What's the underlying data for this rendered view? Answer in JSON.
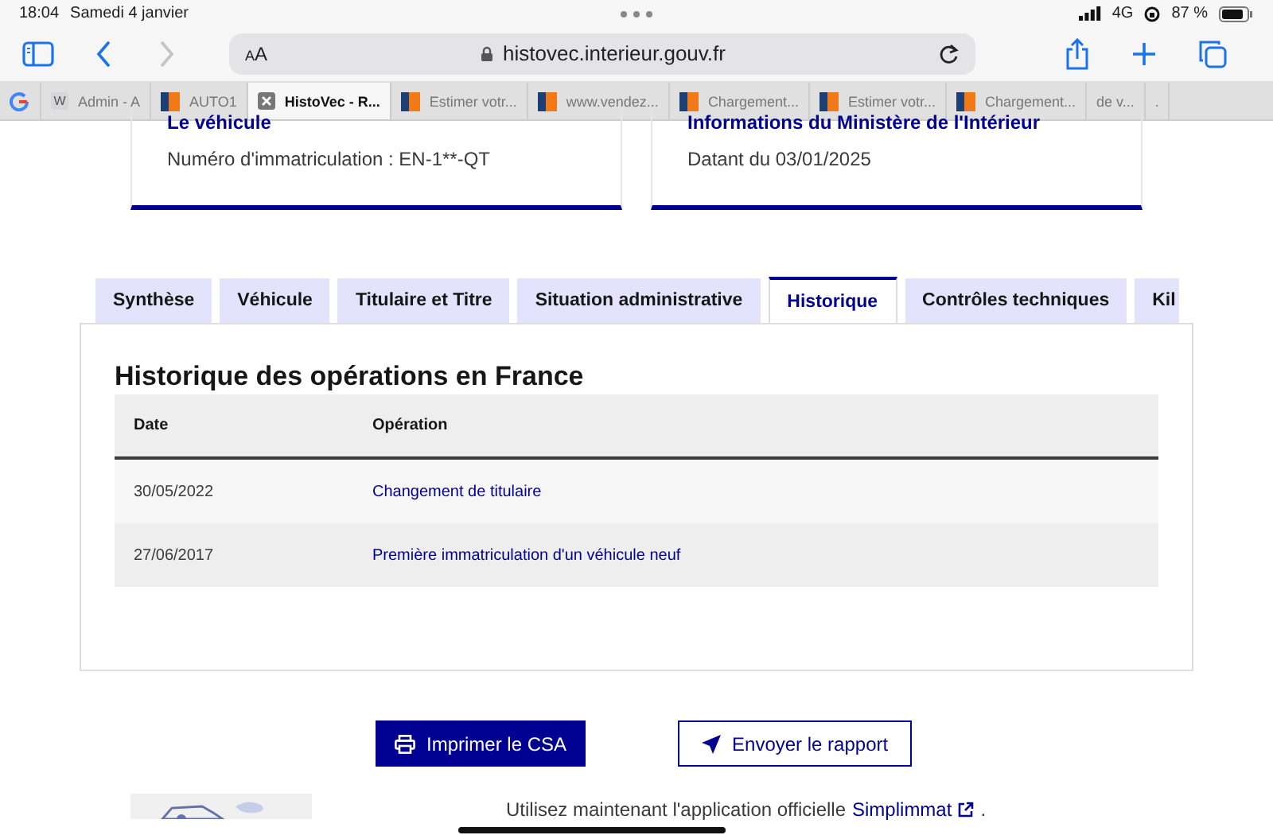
{
  "status_bar": {
    "time": "18:04",
    "date": "Samedi 4 janvier",
    "network": "4G",
    "battery": "87 %"
  },
  "toolbar": {
    "text_size": "AA",
    "url": "histovec.interieur.gouv.fr",
    "forward_disabled": true
  },
  "browser_tabs": [
    {
      "kind": "google",
      "selected": false
    },
    {
      "label": "Admin - A",
      "kind": "letter",
      "letter": "W",
      "selected": false
    },
    {
      "label": "AUTO1",
      "kind": "flag",
      "selected": false
    },
    {
      "label": "HistoVec - R...",
      "kind": "close",
      "selected": true
    },
    {
      "label": "Estimer votr...",
      "kind": "flag",
      "selected": false
    },
    {
      "label": "www.vendez...",
      "kind": "flag",
      "selected": false
    },
    {
      "label": "Chargement...",
      "kind": "flag",
      "selected": false
    },
    {
      "label": "Estimer votr...",
      "kind": "flag",
      "selected": false
    },
    {
      "label": "Chargement...",
      "kind": "flag",
      "selected": false
    },
    {
      "label": "de v...",
      "kind": "plain",
      "selected": false
    },
    {
      "label": ".",
      "kind": "plain",
      "selected": false
    }
  ],
  "cards": [
    {
      "title": "Le véhicule",
      "text": "Numéro d'immatriculation : EN-1**-QT"
    },
    {
      "title": "Informations du Ministère de l'Intérieur",
      "text": "Datant du 03/01/2025"
    }
  ],
  "tabs": [
    {
      "label": "Synthèse",
      "selected": false
    },
    {
      "label": "Véhicule",
      "selected": false
    },
    {
      "label": "Titulaire et Titre",
      "selected": false
    },
    {
      "label": "Situation administrative",
      "selected": false
    },
    {
      "label": "Historique",
      "selected": true
    },
    {
      "label": "Contrôles techniques",
      "selected": false
    },
    {
      "label": "Kil",
      "selected": false
    }
  ],
  "panel": {
    "heading": "Historique des opérations en France",
    "table": {
      "columns": [
        "Date",
        "Opération"
      ],
      "rows": [
        {
          "date": "30/05/2022",
          "operation": "Changement de titulaire"
        },
        {
          "date": "27/06/2017",
          "operation": "Première immatriculation d'un véhicule neuf"
        }
      ]
    }
  },
  "buttons": [
    {
      "label": "Imprimer le CSA",
      "kind": "primary"
    },
    {
      "label": "Envoyer le rapport",
      "kind": "secondary"
    }
  ],
  "footer": {
    "text": "Utilisez maintenant l'application officielle",
    "link": "Simplimmat",
    "end": "."
  }
}
